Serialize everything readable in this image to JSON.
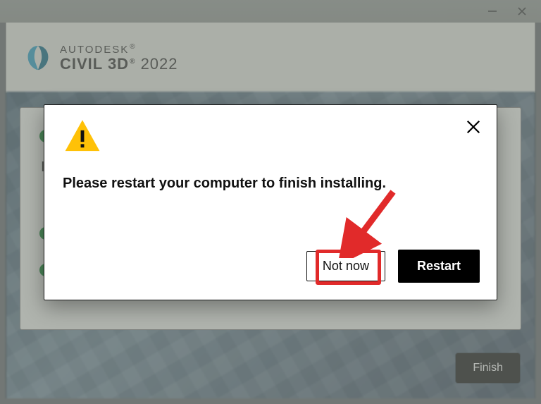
{
  "titlebar": {
    "minimize_tooltip": "Minimize",
    "close_tooltip": "Close"
  },
  "brand": {
    "line1": "AUTODESK",
    "product": "CIVIL 3D",
    "year": "2022"
  },
  "inner": {
    "letter": "I"
  },
  "dialog": {
    "message": "Please restart your computer to finish installing.",
    "not_now_label": "Not now",
    "restart_label": "Restart",
    "close_tooltip": "Close"
  },
  "footer": {
    "finish_label": "Finish"
  },
  "colors": {
    "accent_red": "#e12a2a",
    "warn_yellow": "#ffc107",
    "primary_black": "#000000"
  }
}
